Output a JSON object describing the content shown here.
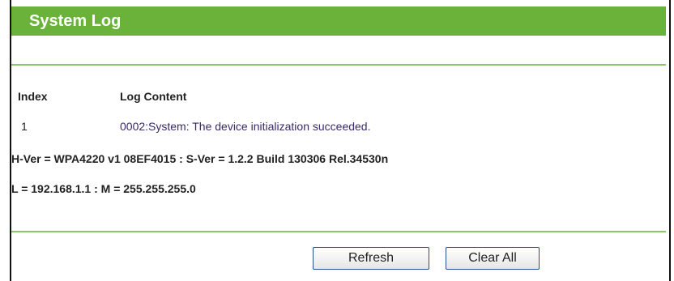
{
  "title": "System Log",
  "table": {
    "headers": [
      "Index",
      "Log Content"
    ],
    "rows": [
      {
        "index": "1",
        "content": "0002:System: The device initialization succeeded."
      }
    ]
  },
  "info": {
    "hver": "H-Ver = WPA4220 v1 08EF4015 : S-Ver = 1.2.2 Build 130306 Rel.34530n",
    "l": "L = 192.168.1.1 : M = 255.255.255.0"
  },
  "buttons": {
    "refresh": "Refresh",
    "clear_all": "Clear All"
  },
  "colors": {
    "title_bar": "#6ab23a",
    "divider": "#8cc66a"
  }
}
